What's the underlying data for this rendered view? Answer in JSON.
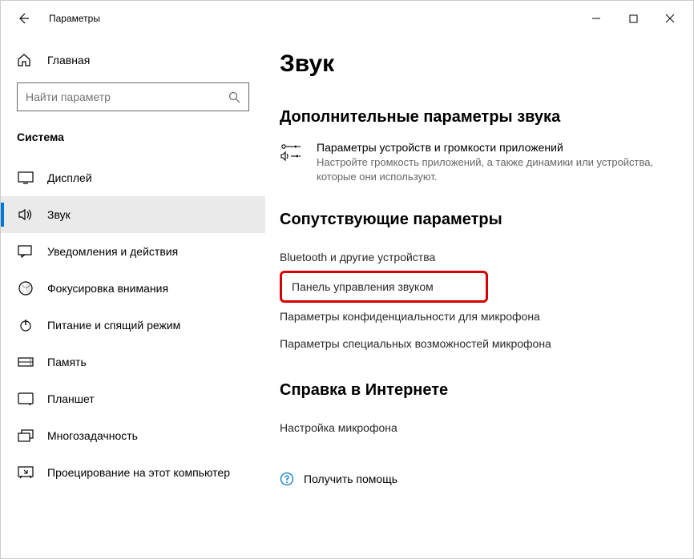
{
  "titlebar": {
    "app_title": "Параметры"
  },
  "sidebar": {
    "home_label": "Главная",
    "search_placeholder": "Найти параметр",
    "category_label": "Система",
    "items": [
      {
        "label": "Дисплей",
        "icon": "display"
      },
      {
        "label": "Звук",
        "icon": "sound",
        "active": true
      },
      {
        "label": "Уведомления и действия",
        "icon": "notifications"
      },
      {
        "label": "Фокусировка внимания",
        "icon": "focus"
      },
      {
        "label": "Питание и спящий режим",
        "icon": "power"
      },
      {
        "label": "Память",
        "icon": "storage"
      },
      {
        "label": "Планшет",
        "icon": "tablet"
      },
      {
        "label": "Многозадачность",
        "icon": "multitask"
      },
      {
        "label": "Проецирование на этот компьютер",
        "icon": "project"
      }
    ]
  },
  "main": {
    "page_title": "Звук",
    "section_advanced": "Дополнительные параметры звука",
    "adv_item": {
      "title": "Параметры устройств и громкости приложений",
      "desc": "Настройте громкость приложений, а также динамики или устройства, которые они используют."
    },
    "section_related": "Сопутствующие параметры",
    "related_links": [
      "Bluetooth и другие устройства",
      "Панель управления звуком",
      "Параметры конфиденциальности для микрофона",
      "Параметры специальных возможностей микрофона"
    ],
    "section_help": "Справка в Интернете",
    "help_link": "Настройка микрофона",
    "get_help": "Получить помощь"
  }
}
